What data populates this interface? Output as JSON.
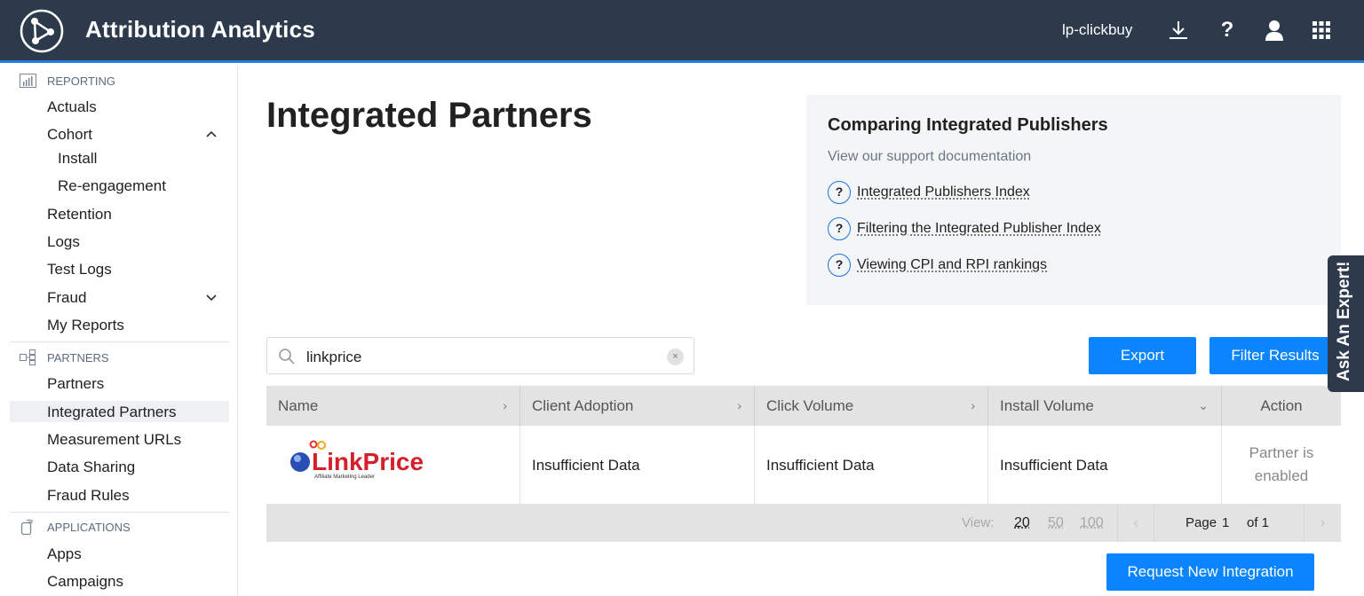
{
  "header": {
    "title": "Attribution Analytics",
    "account": "lp-clickbuy",
    "icons": [
      "download-icon",
      "help-icon",
      "user-icon",
      "apps-grid-icon"
    ],
    "help_glyph": "?"
  },
  "sidebar": {
    "sections": [
      {
        "label": "REPORTING",
        "icon": "chart-icon"
      },
      {
        "label": "PARTNERS",
        "icon": "partners-icon"
      },
      {
        "label": "APPLICATIONS",
        "icon": "device-icon"
      }
    ],
    "reporting": {
      "actuals": "Actuals",
      "cohort": "Cohort",
      "install": "Install",
      "reengagement": "Re-engagement",
      "retention": "Retention",
      "logs": "Logs",
      "test_logs": "Test Logs",
      "fraud": "Fraud",
      "my_reports": "My Reports"
    },
    "partners": {
      "partners": "Partners",
      "integrated_partners": "Integrated Partners",
      "measurement_urls": "Measurement URLs",
      "data_sharing": "Data Sharing",
      "fraud_rules": "Fraud Rules"
    },
    "applications": {
      "apps": "Apps",
      "campaigns": "Campaigns"
    }
  },
  "main": {
    "title": "Integrated Partners",
    "info": {
      "title": "Comparing Integrated Publishers",
      "subtitle": "View our support documentation",
      "links": [
        "Integrated Publishers Index",
        "Filtering the Integrated Publisher Index",
        "Viewing CPI and RPI rankings"
      ],
      "link_glyph": "?"
    },
    "search": {
      "value": "linkprice",
      "clear_glyph": "×"
    },
    "export_label": "Export",
    "filter_label": "Filter Results",
    "request_label": "Request New Integration"
  },
  "table": {
    "columns": [
      "Name",
      "Client Adoption",
      "Click Volume",
      "Install Volume",
      "Action"
    ],
    "sort_glyphs": [
      "›",
      "›",
      "›",
      "⌄"
    ],
    "rows": [
      {
        "name_logo": {
          "text": "LinkPrice",
          "tagline": "Affiliate Marketing Leader"
        },
        "client_adoption": "Insufficient Data",
        "click_volume": "Insufficient Data",
        "install_volume": "Insufficient Data",
        "action_line1": "Partner is",
        "action_line2": "enabled"
      }
    ],
    "footer": {
      "view_label": "View:",
      "page_sizes": [
        "20",
        "50",
        "100"
      ],
      "page_label": "Page",
      "page_current": "1",
      "page_of": "of 1",
      "prev_glyph": "‹",
      "next_glyph": "›"
    }
  },
  "expert_tab": "Ask An Expert!",
  "colors": {
    "header_bg": "#2c3a4c",
    "accent": "#0a84ff",
    "header_underline": "#1f7ee0"
  }
}
